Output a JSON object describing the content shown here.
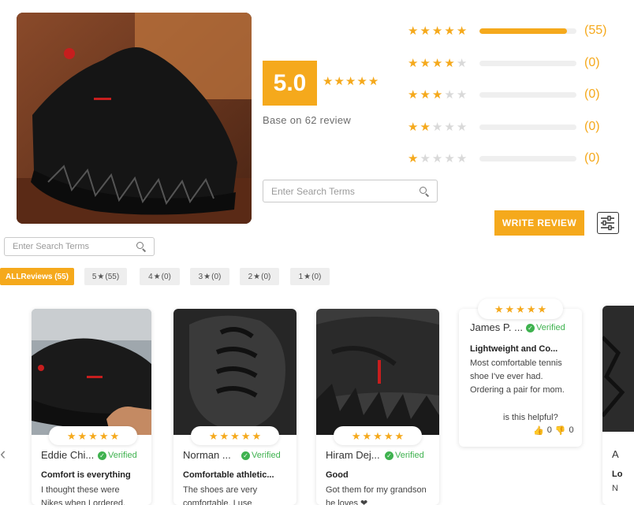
{
  "summary": {
    "score": "5.0",
    "base_text": "Base on 62 review",
    "distribution": [
      {
        "stars": 5,
        "count": "(55)",
        "fill": 0.9
      },
      {
        "stars": 4,
        "count": "(0)",
        "fill": 0
      },
      {
        "stars": 3,
        "count": "(0)",
        "fill": 0
      },
      {
        "stars": 2,
        "count": "(0)",
        "fill": 0
      },
      {
        "stars": 1,
        "count": "(0)",
        "fill": 0
      }
    ]
  },
  "search_main": {
    "placeholder": "Enter Search Terms"
  },
  "search_sub": {
    "placeholder": "Enter Search Terms"
  },
  "write_review_label": "WRITE REVIEW",
  "filters": [
    {
      "label": "ALLReviews (55)"
    },
    {
      "num": "5",
      "count": "(55)"
    },
    {
      "num": "4",
      "count": "(0)"
    },
    {
      "num": "3",
      "count": "(0)"
    },
    {
      "num": "2",
      "count": "(0)"
    },
    {
      "num": "1",
      "count": "(0)"
    }
  ],
  "reviews": [
    {
      "name": "Eddie Chi...",
      "verified": "Verified",
      "title": "Comfort is everything",
      "body": "I thought these were Nikes when I ordered,"
    },
    {
      "name": "Norman ...",
      "verified": "Verified",
      "title": "Comfortable athletic...",
      "body": "The shoes are very comfortable. I use"
    },
    {
      "name": "Hiram Dej...",
      "verified": "Verified",
      "title": "Good",
      "body": "Got them for my grandson he loves ❤"
    },
    {
      "name": "James P. ...",
      "verified": "Verified",
      "title": "Lightweight and Co...",
      "body": "Most comfortable tennis shoe I've ever had. Ordering a pair for mom.",
      "helpful": "is this helpful?",
      "up": "0",
      "down": "0"
    },
    {
      "name": "A",
      "title": "Lo",
      "body": "N"
    }
  ],
  "colors": {
    "accent": "#f5a91c",
    "verified": "#3fb24f"
  }
}
